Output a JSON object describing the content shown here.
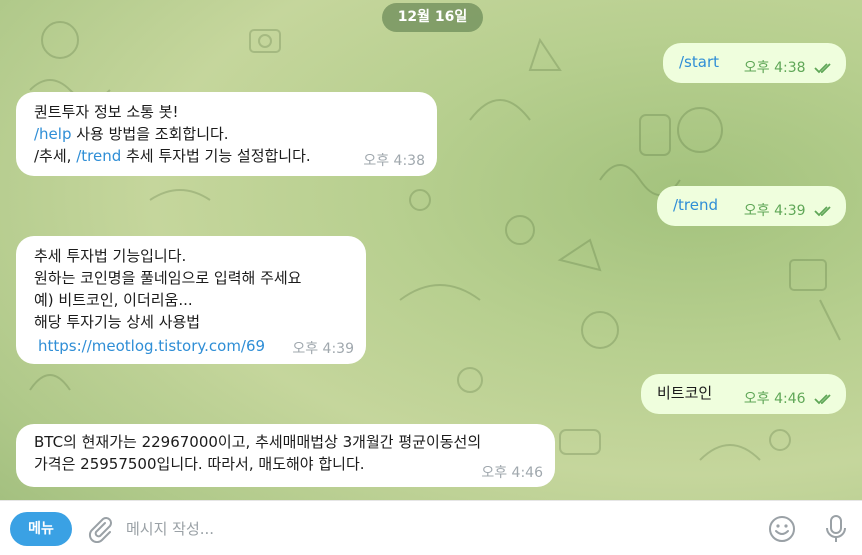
{
  "date_label": "12월 16일",
  "messages": [
    {
      "direction": "out",
      "text": "/start",
      "time": "오후 4:38",
      "read": true
    },
    {
      "direction": "in",
      "lines": [
        "퀀트투자 정보 소통 봇!",
        "/help 사용 방법을 조회합니다.",
        "/추세, /trend 추세 투자법 기능 설정합니다."
      ],
      "time": "오후 4:38",
      "help_cmd": "/help",
      "help_text": " 사용 방법을 조회합니다.",
      "trend_prefix": "/추세, ",
      "trend_cmd": "/trend",
      "trend_text": " 추세 투자법 기능 설정합니다."
    },
    {
      "direction": "out",
      "text": "/trend",
      "time": "오후 4:39",
      "read": true
    },
    {
      "direction": "in",
      "lines": [
        "추세 투자법 기능입니다.",
        "원하는 코인명을 풀네임으로 입력해 주세요",
        "예) 비트코인, 이더리움...",
        "해당 투자기능 상세 사용법"
      ],
      "link": "https://meotlog.tistory.com/69",
      "time": "오후 4:39"
    },
    {
      "direction": "out",
      "text": "비트코인",
      "time": "오후 4:46",
      "read": true
    },
    {
      "direction": "in",
      "lines": [
        "BTC의 현재가는 22967000이고, 추세매매법상 3개월간 평균이동선의",
        "가격은 25957500입니다. 따라서, 매도해야 합니다."
      ],
      "time": "오후 4:46"
    }
  ],
  "composer": {
    "menu_label": "메뉴",
    "placeholder": "메시지 작성...",
    "value": ""
  },
  "icons": {
    "attach": "paperclip-icon",
    "emoji": "smiley-icon",
    "mic": "microphone-icon",
    "read_receipt": "double-check-icon"
  },
  "colors": {
    "menu_button": "#3aa1e4",
    "link": "#2f8ed6",
    "outgoing_bubble": "#effedd",
    "outgoing_meta": "#5fa757"
  }
}
